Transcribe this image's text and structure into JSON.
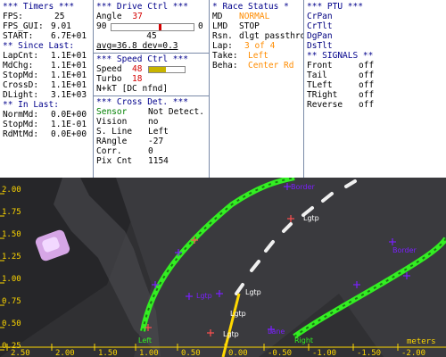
{
  "timers": {
    "header": "*** Timers ***",
    "rows": [
      {
        "label": "FPS:",
        "value": "25"
      },
      {
        "label": "FPS_GUI:",
        "value": "9.01"
      },
      {
        "label": "START:",
        "value": "6.7E+01"
      }
    ],
    "since_header": "** Since Last:",
    "since_rows": [
      {
        "label": "LapCnt:",
        "value": "1.1E+01"
      },
      {
        "label": "MdChg:",
        "value": "1.1E+01"
      },
      {
        "label": "StopMd:",
        "value": "1.1E+01"
      },
      {
        "label": "CrossD:",
        "value": "1.1E+01"
      },
      {
        "label": "DLight:",
        "value": "3.1E+03"
      }
    ],
    "in_header": "** In Last:",
    "in_rows": [
      {
        "label": "NormMd:",
        "value": "0.0E+00"
      },
      {
        "label": "StopMd:",
        "value": "1.1E-01"
      },
      {
        "label": "RdMtMd:",
        "value": "0.0E+00"
      }
    ]
  },
  "drive": {
    "header": "***  Drive Ctrl  ***",
    "angle_label": "Angle",
    "angle_value": "37",
    "slider_min": "90",
    "slider_max": "0",
    "slider_fraction": 0.6,
    "slider_center": "45",
    "avg_text": "avg=36.8 dev=0.3",
    "speed_header": "***  Speed Ctrl  ***",
    "speed_label": "Speed",
    "speed_value": "48",
    "speed_fraction": 0.48,
    "turbo_label": "Turbo",
    "turbo_value": "18",
    "nt_text": "N+kT [DC nfnd]",
    "cross_header": "*** Cross Det. ***",
    "cross_rows": [
      {
        "label": "Sensor",
        "value": "Not Detect."
      },
      {
        "label": "Vision",
        "value": "no"
      },
      {
        "label": "S. Line",
        "value": "Left"
      },
      {
        "label": "RAngle",
        "value": "-27"
      },
      {
        "label": "Corr.",
        "value": "0"
      },
      {
        "label": "Pix Cnt",
        "value": "1154"
      }
    ]
  },
  "race": {
    "header": "* Race Status *",
    "md_label": "MD",
    "md_value": "NORMAL",
    "lmd_label": "LMD",
    "lmd_value": "STOP",
    "rsn_label": "Rsn.",
    "rsn_value": "dlgt passthrough",
    "lap_label": "Lap:",
    "lap_value": "3 of 4",
    "take_label": "Take:",
    "take_value": "Left",
    "beha_label": "Beha:",
    "beha_value": "Center Rd"
  },
  "ptu": {
    "header": "*** PTU ***",
    "items": [
      "CrPan",
      "CrTlt",
      "DgPan",
      "DsTlt"
    ],
    "signals_header": "** SIGNALS **",
    "signals": [
      {
        "label": "Front",
        "value": "off"
      },
      {
        "label": "Tail",
        "value": "off"
      },
      {
        "label": "TLeft",
        "value": "off"
      },
      {
        "label": "TRight",
        "value": "off"
      },
      {
        "label": "Reverse",
        "value": "off"
      }
    ]
  },
  "view": {
    "y_ticks": [
      "2.00",
      "1.75",
      "1.50",
      "1.25",
      "1.00",
      "0.75",
      "0.50",
      "0.25"
    ],
    "x_ticks": [
      "2.50",
      "2.00",
      "1.50",
      "1.00",
      "0.50",
      "0.00",
      "-0.50",
      "-1.00",
      "-1.50",
      "-2.00"
    ],
    "x_unit": "meters",
    "marker_labels": [
      "Left",
      "Right",
      "Border",
      "Lgtp",
      "Lgtp",
      "Lgtp",
      "Lgtp",
      "Border",
      "Lgtp",
      "Lane"
    ]
  },
  "colors": {
    "header": "#00008b",
    "value_red": "#d40000",
    "value_orange": "#ff8c00",
    "sensor_green": "#008000",
    "lane_green": "#33ee22",
    "marker_purple": "#7b1fff",
    "axis_yellow": "#ffd800"
  }
}
